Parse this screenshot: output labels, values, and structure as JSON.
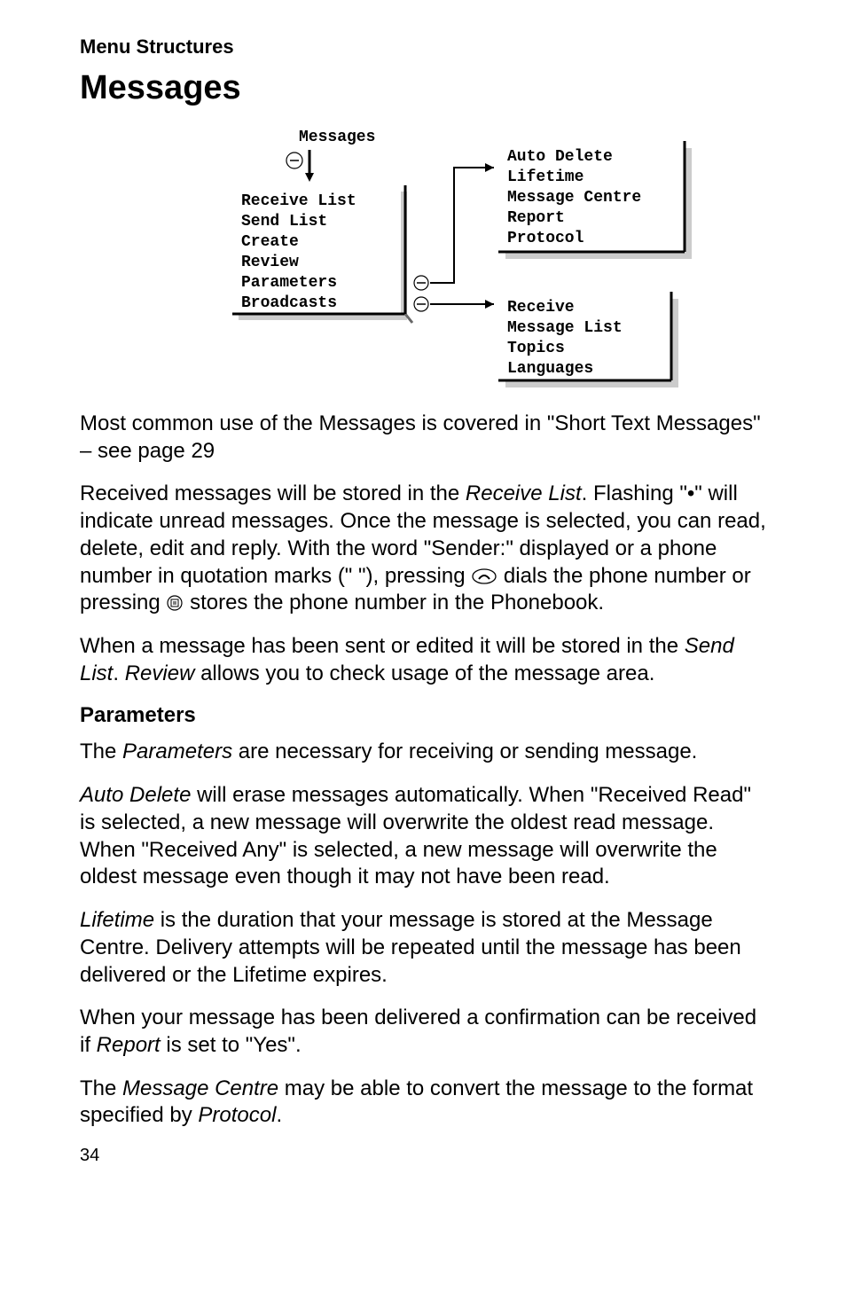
{
  "header": "Menu Structures",
  "title": "Messages",
  "diagram": {
    "top_label": "Messages",
    "left_list": [
      "Receive List",
      "Send List",
      "Create",
      "Review",
      "Parameters",
      "Broadcasts"
    ],
    "top_right_list": [
      "Auto Delete",
      "Lifetime",
      "Message Centre",
      "Report",
      "Protocol"
    ],
    "bottom_right_list": [
      "Receive",
      "Message List",
      "Topics",
      "Languages"
    ]
  },
  "p1a": "Most common use of the Messages is covered in \"Short Text Messages\" – see page 29",
  "p2a": "Received messages will be stored in the ",
  "p2b": "Receive List",
  "p2c": ". Flashing \"•\" will indicate unread messages. Once the message is selected, you can read, delete, edit and reply. With the word \"Sender:\" displayed or a phone number in quotation marks (\" \"), pressing ",
  "p2d": " dials the phone number or pressing ",
  "p2e": " stores the phone number in the Phonebook.",
  "p3a": "When a message has been sent or edited it will be stored in the ",
  "p3b": "Send List",
  "p3c": ". ",
  "p3d": "Review",
  "p3e": " allows you to check usage of the message area.",
  "subhead_parameters": "Parameters",
  "p4a": "The ",
  "p4b": "Parameters",
  "p4c": " are necessary for receiving or sending message.",
  "p5a": "Auto Delete",
  "p5b": " will erase messages automatically. When \"Received Read\" is selected, a new message will overwrite the oldest read message. When \"Received Any\" is selected, a new message will overwrite the oldest message even though it may not have been read.",
  "p6a": "Lifetime",
  "p6b": " is the duration that your message is stored at the Message Centre. Delivery attempts will be repeated until the message has been delivered or the Lifetime expires.",
  "p7a": "When your message has been delivered a confirmation can be received if ",
  "p7b": "Report",
  "p7c": " is set to \"Yes\".",
  "p8a": "The ",
  "p8b": "Message Centre",
  "p8c": " may be able to convert the message to the format specified by ",
  "p8d": "Protocol",
  "p8e": ".",
  "page_number": "34"
}
